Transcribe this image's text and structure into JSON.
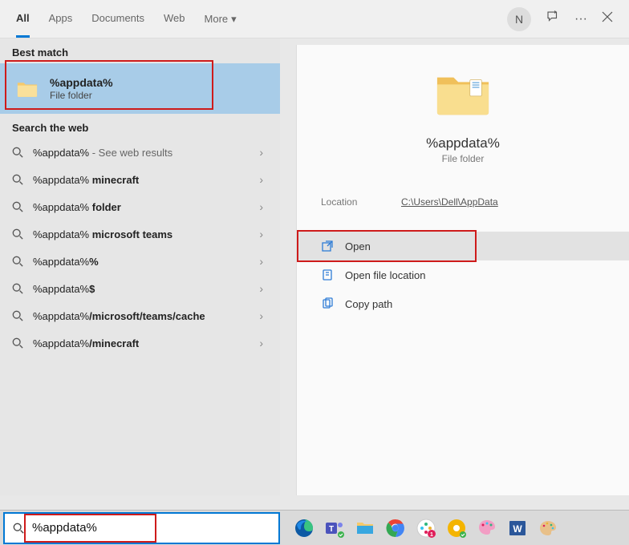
{
  "tabs": [
    "All",
    "Apps",
    "Documents",
    "Web",
    "More"
  ],
  "avatar_letter": "N",
  "best_match_header": "Best match",
  "best_match": {
    "title": "%appdata%",
    "subtitle": "File folder"
  },
  "search_web_header": "Search the web",
  "suggestions": [
    {
      "pre": "%appdata%",
      "bold": "",
      "suffix": " - See web results"
    },
    {
      "pre": "%appdata%",
      "bold": " minecraft",
      "suffix": ""
    },
    {
      "pre": "%appdata%",
      "bold": " folder",
      "suffix": ""
    },
    {
      "pre": "%appdata%",
      "bold": " microsoft teams",
      "suffix": ""
    },
    {
      "pre": "%appdata%",
      "bold": "%",
      "suffix": ""
    },
    {
      "pre": "%appdata%",
      "bold": "$",
      "suffix": ""
    },
    {
      "pre": "%appdata%",
      "bold": "/microsoft/teams/cache",
      "suffix": ""
    },
    {
      "pre": "%appdata%",
      "bold": "/minecraft",
      "suffix": ""
    }
  ],
  "preview": {
    "title": "%appdata%",
    "subtitle": "File folder"
  },
  "location_label": "Location",
  "location_value": "C:\\Users\\Dell\\AppData",
  "actions": {
    "open": "Open",
    "open_loc": "Open file location",
    "copy_path": "Copy path"
  },
  "search_value": "%appdata%"
}
